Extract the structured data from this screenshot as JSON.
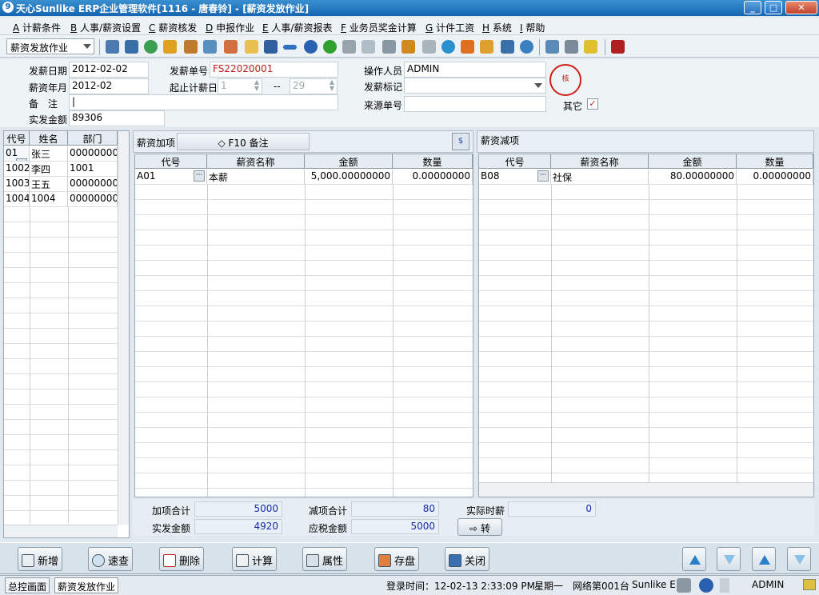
{
  "window": {
    "title": "天心Sunlike ERP企业管理软件[1116 - 唐春铃] - [薪资发放作业]",
    "minimize": "_",
    "maximize": "□",
    "close": "✕"
  },
  "menu": [
    {
      "key": "A",
      "label": " 计薪条件"
    },
    {
      "key": "B",
      "label": " 人事/薪资设置"
    },
    {
      "key": "C",
      "label": " 薪资核发"
    },
    {
      "key": "D",
      "label": " 申报作业"
    },
    {
      "key": "E",
      "label": " 人事/薪资报表"
    },
    {
      "key": "F",
      "label": " 业务员奖金计算"
    },
    {
      "key": "G",
      "label": " 计件工资"
    },
    {
      "key": "H",
      "label": " 系统"
    },
    {
      "key": "I",
      "label": " 帮助"
    }
  ],
  "toolbar": {
    "mode_select": "薪资发放作业"
  },
  "header": {
    "pay_date_label": "发薪日期",
    "pay_date": "2012-02-02",
    "pay_month_label": "薪资年月",
    "pay_month": "2012-02",
    "remark_label": "备　注",
    "remark": "|",
    "net_amount_label": "实发金额",
    "net_amount": "89306",
    "pay_no_label": "发薪单号",
    "pay_no": "FS22020001",
    "range_label": "起止计薪日",
    "range_from": "1",
    "range_sep": "--",
    "range_to": "29",
    "operator_label": "操作人员",
    "operator": "ADMIN",
    "flag_label": "发薪标记",
    "flag": "",
    "source_label": "来源单号",
    "source": "",
    "other_label": "其它",
    "other_checked": "✓",
    "stamp_text": "核"
  },
  "employee_grid": {
    "columns": [
      "代号",
      "姓名",
      "部门"
    ],
    "rows": [
      [
        "01",
        "张三",
        "00000000"
      ],
      [
        "1002",
        "李四",
        "1001"
      ],
      [
        "1003",
        "王五",
        "00000000"
      ],
      [
        "1004",
        "1004",
        "00000000"
      ]
    ]
  },
  "add_panel": {
    "title": "薪资加项",
    "remark_button": "F10 备注",
    "columns": [
      "代号",
      "薪资名称",
      "金额",
      "数量"
    ],
    "rows": [
      [
        "A01",
        "本薪",
        "5,000.00000000",
        "0.00000000"
      ]
    ]
  },
  "deduct_panel": {
    "title": "薪资减项",
    "columns": [
      "代号",
      "薪资名称",
      "金额",
      "数量"
    ],
    "rows": [
      [
        "B08",
        "社保",
        "80.00000000",
        "0.00000000"
      ]
    ]
  },
  "totals": {
    "add_total_label": "加项合计",
    "add_total": "5000",
    "deduct_total_label": "减项合计",
    "deduct_total": "80",
    "actual_label": "实际时薪",
    "actual": "0",
    "net_label": "实发金额",
    "net": "4920",
    "taxable_label": "应税金额",
    "taxable": "5000",
    "transfer_button": "转"
  },
  "buttons": {
    "add": "新增",
    "query": "速查",
    "delete": "删除",
    "calc": "计算",
    "props": "属性",
    "save": "存盘",
    "close": "关闭"
  },
  "statusbar": {
    "tab1": "总控画面",
    "tab2": "薪资发放作业",
    "login": "登录时间：12-02-13 2:33:09 PM",
    "weekday": "星期一",
    "network": "网络第001台",
    "product": "Sunlike E",
    "user": "ADMIN"
  },
  "colors": {
    "title_bar": "#1566b0",
    "stamp": "#d0201a",
    "total_value": "#1a2ab0",
    "pay_no": "#c02020"
  }
}
